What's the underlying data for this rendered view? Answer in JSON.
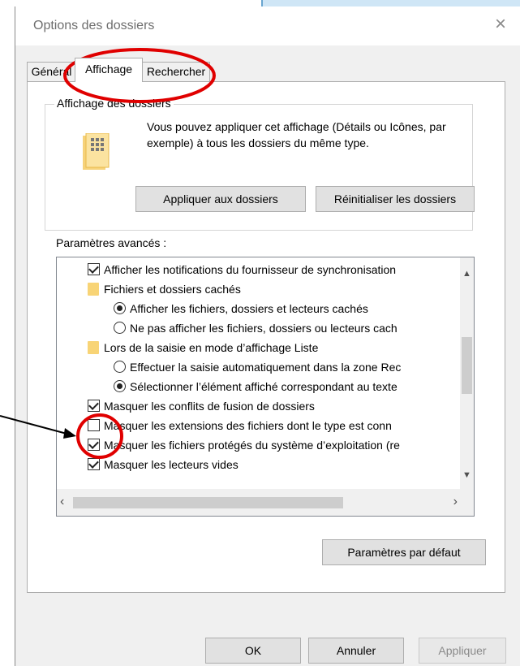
{
  "dialog": {
    "title": "Options des dossiers",
    "close_glyph": "×"
  },
  "tabs": [
    {
      "label": "Général",
      "selected": false
    },
    {
      "label": "Affichage",
      "selected": true
    },
    {
      "label": "Rechercher",
      "selected": false
    }
  ],
  "folder_views": {
    "title": "Affichage des dossiers",
    "description": "Vous pouvez appliquer cet affichage (Détails ou Icônes, par exemple) à tous les dossiers du même type.",
    "apply_button": "Appliquer aux dossiers",
    "reset_button": "Réinitialiser les dossiers"
  },
  "advanced": {
    "label": "Paramètres avancés :",
    "rows": [
      {
        "type": "checkbox",
        "checked": true,
        "text": "Afficher les notifications du fournisseur de synchronisation"
      },
      {
        "type": "folder",
        "text": "Fichiers et dossiers cachés"
      },
      {
        "type": "radio",
        "checked": true,
        "text": "Afficher les fichiers, dossiers et lecteurs cachés"
      },
      {
        "type": "radio",
        "checked": false,
        "text": "Ne pas afficher les fichiers, dossiers ou lecteurs cach"
      },
      {
        "type": "folder",
        "text": "Lors de la saisie en mode d’affichage Liste"
      },
      {
        "type": "radio",
        "checked": false,
        "text": "Effectuer la saisie automatiquement dans la zone Rec"
      },
      {
        "type": "radio",
        "checked": true,
        "text": "Sélectionner l’élément affiché correspondant au texte"
      },
      {
        "type": "checkbox",
        "checked": true,
        "text": "Masquer les conflits de fusion de dossiers"
      },
      {
        "type": "checkbox",
        "checked": false,
        "text": "Masquer les extensions des fichiers dont le type est conn"
      },
      {
        "type": "checkbox",
        "checked": true,
        "text": "Masquer les fichiers protégés du système d’exploitation (re"
      },
      {
        "type": "checkbox",
        "checked": true,
        "text": "Masquer les lecteurs vides"
      }
    ]
  },
  "buttons": {
    "defaults": "Paramètres par défaut",
    "ok": "OK",
    "cancel": "Annuler",
    "apply": "Appliquer"
  },
  "colors": {
    "annotation_red": "#e00000",
    "folder_yellow": "#f8d476"
  },
  "icons": [
    "close-icon",
    "folder-options-icon",
    "folder-icon",
    "chevron-up-icon",
    "chevron-down-icon",
    "chevron-left-icon",
    "chevron-right-icon"
  ]
}
